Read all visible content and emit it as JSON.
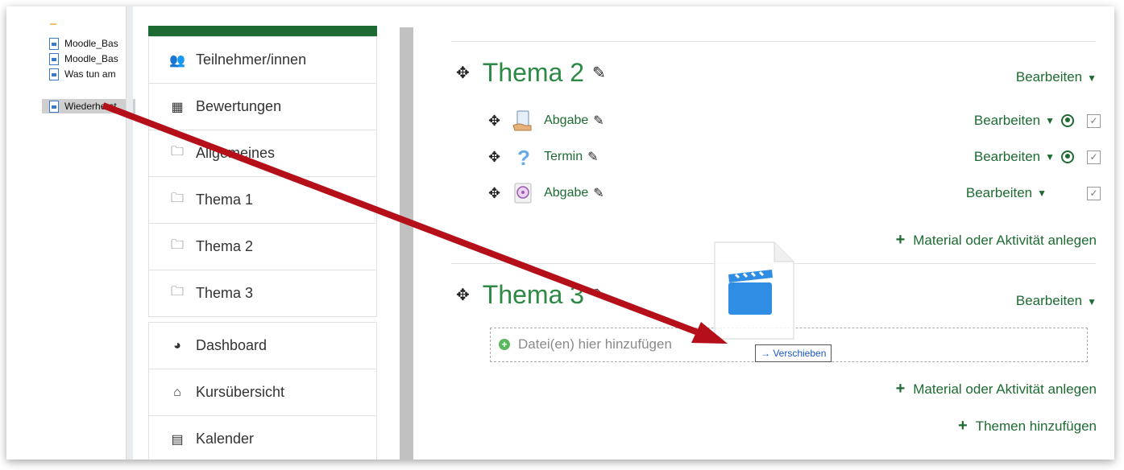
{
  "explorer": {
    "files": [
      "Moodle_Bas",
      "Moodle_Bas",
      "Was tun am",
      "Wiederherst"
    ]
  },
  "nav": {
    "items": [
      {
        "label": "Teilnehmer/innen",
        "icon": "users-icon"
      },
      {
        "label": "Bewertungen",
        "icon": "table-icon"
      },
      {
        "label": "Allgemeines",
        "icon": "folder-icon"
      },
      {
        "label": "Thema 1",
        "icon": "folder-icon"
      },
      {
        "label": "Thema 2",
        "icon": "folder-icon"
      },
      {
        "label": "Thema 3",
        "icon": "folder-icon"
      }
    ],
    "items2": [
      {
        "label": "Dashboard",
        "icon": "dashboard-icon"
      },
      {
        "label": "Kursübersicht",
        "icon": "home-icon"
      },
      {
        "label": "Kalender",
        "icon": "calendar-icon"
      }
    ]
  },
  "sections": [
    {
      "title": "Thema 2",
      "edit_label": "Bearbeiten",
      "activities": [
        {
          "name": "Abgabe",
          "icon": "assignment-icon",
          "edit_label": "Bearbeiten",
          "has_role": true
        },
        {
          "name": "Termin",
          "icon": "help-icon",
          "edit_label": "Bearbeiten",
          "has_role": true
        },
        {
          "name": "Abgabe",
          "icon": "media-icon",
          "edit_label": "Bearbeiten",
          "has_role": false
        }
      ],
      "add_label": "Material oder Aktivität anlegen"
    },
    {
      "title": "Thema 3",
      "edit_label": "Bearbeiten",
      "dropzone_label": "Datei(en) hier hinzufügen",
      "add_label": "Material oder Aktivität anlegen"
    }
  ],
  "add_topics_label": "Themen hinzufügen",
  "drag_tooltip": "→ Verschieben",
  "colors": {
    "accent": "#1d6b32",
    "arrow": "#b5101a",
    "title": "#2d8a44"
  }
}
